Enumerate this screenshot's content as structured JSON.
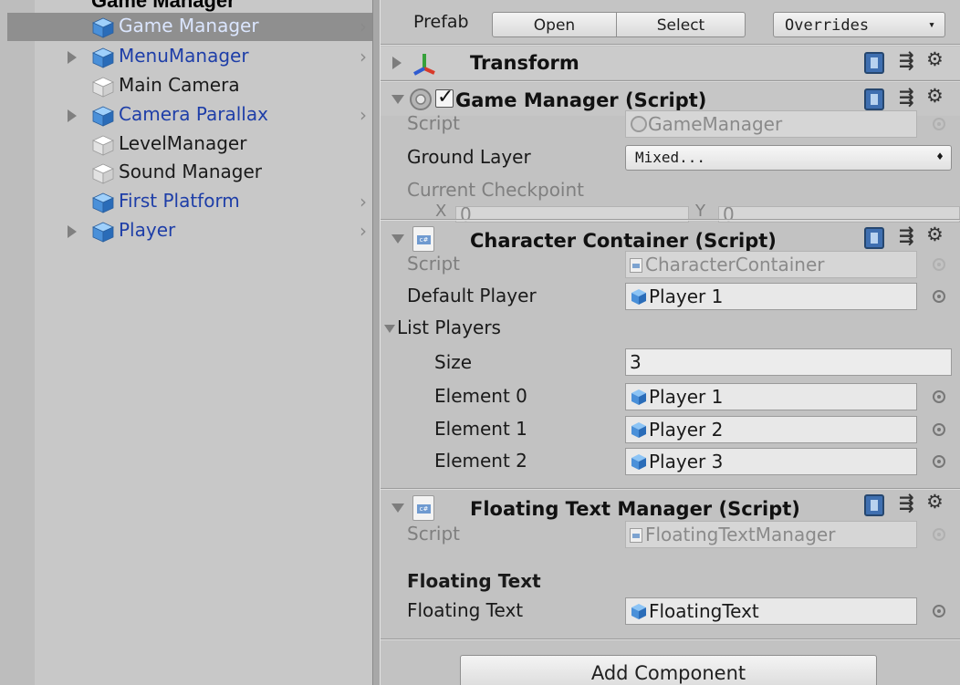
{
  "hierarchy": {
    "top_cut_label": "Game Manager",
    "items": [
      {
        "label": "Game Manager",
        "kind": "prefab",
        "selected": true,
        "expandable": false,
        "chevron": true
      },
      {
        "label": "MenuManager",
        "kind": "prefab",
        "selected": false,
        "expandable": true,
        "chevron": true
      },
      {
        "label": "Main Camera",
        "kind": "plain",
        "selected": false,
        "expandable": false,
        "chevron": false
      },
      {
        "label": "Camera Parallax",
        "kind": "prefab",
        "selected": false,
        "expandable": true,
        "chevron": true
      },
      {
        "label": "LevelManager",
        "kind": "plain",
        "selected": false,
        "expandable": false,
        "chevron": false
      },
      {
        "label": "Sound Manager",
        "kind": "plain",
        "selected": false,
        "expandable": false,
        "chevron": false
      },
      {
        "label": "First Platform",
        "kind": "prefab",
        "selected": false,
        "expandable": false,
        "chevron": true
      },
      {
        "label": "Player",
        "kind": "prefab",
        "selected": false,
        "expandable": true,
        "chevron": true
      }
    ],
    "chevron_glyph": "›"
  },
  "prefab_bar": {
    "label": "Prefab",
    "open_label": "Open",
    "select_label": "Select",
    "overrides_label": "Overrides",
    "overrides_arrow": "▾"
  },
  "transform": {
    "title": "Transform"
  },
  "game_manager": {
    "title": "Game Manager (Script)",
    "script_label": "Script",
    "script_value": "GameManager",
    "ground_layer_label": "Ground Layer",
    "ground_layer_value": "Mixed...",
    "ground_layer_arrow": "♦",
    "current_checkpoint_label": "Current Checkpoint",
    "x_label": "X",
    "x_value": "0",
    "y_label": "Y",
    "y_value": "0"
  },
  "character_container": {
    "title": "Character Container (Script)",
    "script_label": "Script",
    "script_value": "CharacterContainer",
    "default_player_label": "Default Player",
    "default_player_value": "Player 1",
    "list_players_label": "List Players",
    "size_label": "Size",
    "size_value": "3",
    "elements": [
      {
        "label": "Element 0",
        "value": "Player 1"
      },
      {
        "label": "Element 1",
        "value": "Player 2"
      },
      {
        "label": "Element 2",
        "value": "Player 3"
      }
    ]
  },
  "floating_text_manager": {
    "title": "Floating Text Manager (Script)",
    "script_label": "Script",
    "script_value": "FloatingTextManager",
    "section_header": "Floating Text",
    "floating_text_label": "Floating Text",
    "floating_text_value": "FloatingText"
  },
  "add_component_label": "Add Component",
  "script_icon_text": "c#",
  "colors": {
    "prefab_text": "#1e3ea8",
    "selected_row": "#8f8f8f",
    "panel_bg": "#c2c2c2",
    "cube_blue": "#4a90d9"
  }
}
